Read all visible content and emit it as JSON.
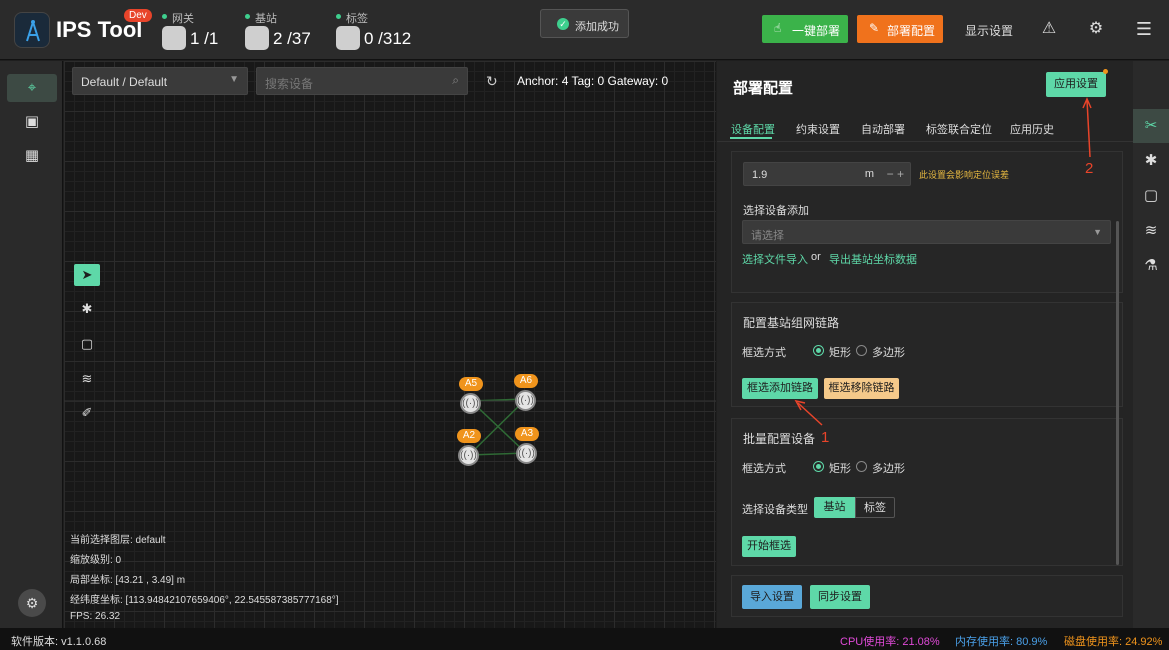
{
  "header": {
    "app_name": "IPS Tool",
    "dev_badge": "Dev",
    "gateway": {
      "label": "网关",
      "value": "1 /1"
    },
    "anchor": {
      "label": "基站",
      "value": "2 /37"
    },
    "tag": {
      "label": "标签",
      "value": "0 /312"
    },
    "toast": "添加成功",
    "btn_one_click": "一键部署",
    "btn_deploy": "部署配置",
    "btn_display": "显示设置"
  },
  "toolbar": {
    "layer_select": "Default / Default",
    "search_placeholder": "搜索设备",
    "counts": "Anchor: 4   Tag: 0   Gateway: 0"
  },
  "devices": [
    "A5",
    "A6",
    "A2",
    "A3"
  ],
  "map_info": {
    "layer": "当前选择图层:   default",
    "zoom": "缩放级别:   0",
    "local": "局部坐标:   [43.21 ,  3.49] m",
    "lnglat": "经纬度坐标:   [113.94842107659406°,  22.545587385777168°]",
    "fps": "FPS:   26.32"
  },
  "panel": {
    "title": "部署配置",
    "apply": "应用设置",
    "tabs": [
      "设备配置",
      "约束设置",
      "自动部署",
      "标签联合定位",
      "应用历史"
    ],
    "height_value": "1.9",
    "height_unit": "m",
    "height_warn": "此设置会影响定位误差",
    "select_device_label": "选择设备添加",
    "select_placeholder": "请选择",
    "link_import_file": "选择文件导入",
    "or": "or",
    "link_export": "导出基站坐标数据",
    "link_section_title": "配置基站组网链路",
    "box_mode": "框选方式",
    "rect": "矩形",
    "polygon": "多边形",
    "btn_add_link": "框选添加链路",
    "btn_remove_link": "框选移除链路",
    "batch_title": "批量配置设备",
    "device_type_label": "选择设备类型",
    "type_anchor": "基站",
    "type_tag": "标签",
    "btn_start_select": "开始框选",
    "btn_import": "导入设置",
    "btn_sync": "同步设置"
  },
  "annotations": {
    "n1": "1",
    "n2": "2"
  },
  "status": {
    "version": "软件版本:  v1.1.0.68",
    "cpu": "CPU使用率:  21.08%",
    "mem": "内存使用率:  80.9%",
    "disk": "磁盘使用率:  24.92%"
  },
  "colors": {
    "accent": "#5ed8a8",
    "warn": "#e6b840",
    "orange": "#f0721c",
    "green": "#3bb34a"
  }
}
